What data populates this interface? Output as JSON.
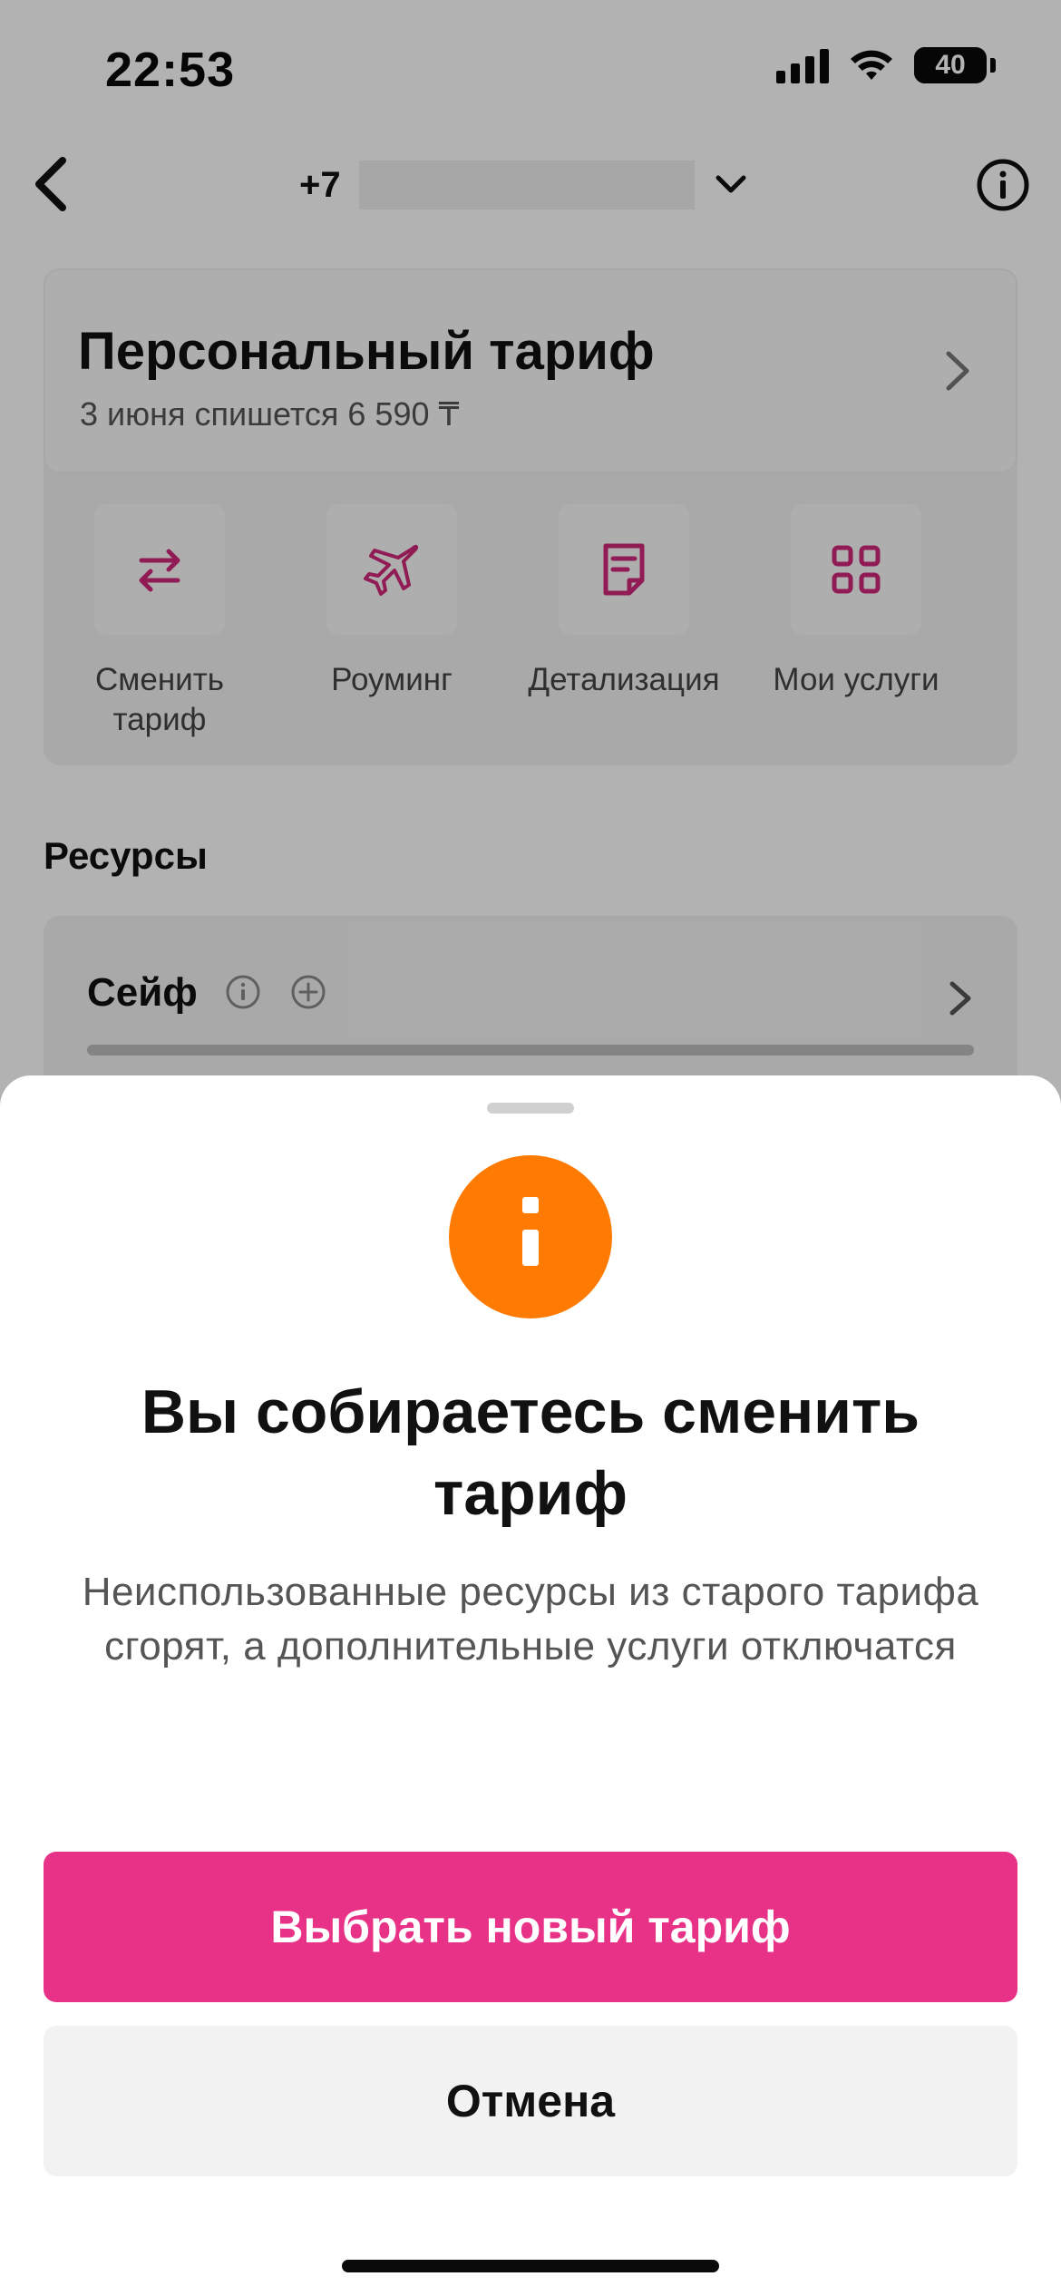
{
  "status_bar": {
    "time": "22:53",
    "battery": "40",
    "battery_level": 0.4
  },
  "topnav": {
    "phone_prefix": "+7"
  },
  "tariff": {
    "name": "Персональный тариф",
    "subtitle": "3 июня спишется 6 590 ₸"
  },
  "actions": [
    {
      "label": "Сменить тариф",
      "icon": "swap-arrows-icon"
    },
    {
      "label": "Роуминг",
      "icon": "airplane-icon"
    },
    {
      "label": "Детализация",
      "icon": "document-icon"
    },
    {
      "label": "Мои услуги",
      "icon": "grid-icon"
    }
  ],
  "resources": {
    "title": "Ресурсы",
    "safe": {
      "title": "Сейф"
    }
  },
  "sheet": {
    "title": "Вы собираетесь сменить тариф",
    "text": "Неиспользованные ресурсы из старого тарифа сгорят, а дополнительные услуги отключатся",
    "primary_button": "Выбрать новый тариф",
    "secondary_button": "Отмена"
  },
  "colors": {
    "accent": "#e83287",
    "alert": "#ff7a00"
  }
}
